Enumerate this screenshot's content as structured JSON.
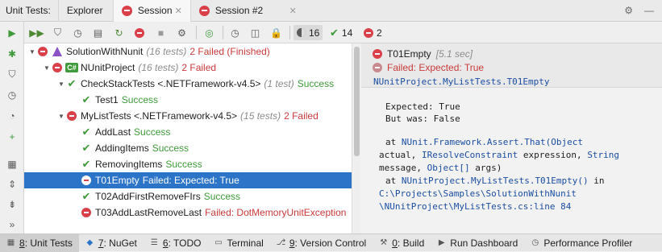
{
  "titlebar": {
    "label": "Unit Tests:",
    "tabs": [
      {
        "label": "Explorer"
      },
      {
        "label": "Session"
      },
      {
        "label": "Session #2"
      }
    ]
  },
  "toolbar": {
    "counters": {
      "all": "16",
      "passed": "14",
      "failed": "2"
    }
  },
  "tree": [
    {
      "name": "SolutionWithNunit",
      "meta": "(16 tests)",
      "status": "2 Failed (Finished)"
    },
    {
      "name": "NUnitProject",
      "meta": "(16 tests)",
      "status": "2 Failed"
    },
    {
      "name": "CheckStackTests <.NETFramework-v4.5>",
      "meta": "(1 test)",
      "status": "Success"
    },
    {
      "name": "Test1",
      "status": "Success"
    },
    {
      "name": "MyListTests <.NETFramework-v4.5>",
      "meta": "(15 tests)",
      "status": "2 Failed"
    },
    {
      "name": "AddLast",
      "status": "Success"
    },
    {
      "name": "AddingItems",
      "status": "Success"
    },
    {
      "name": "RemovingItems",
      "status": "Success"
    },
    {
      "name": "T01Empty",
      "status": "Failed:  Expected: True"
    },
    {
      "name": "T02AddFirstRemoveFIrs",
      "status": "Success"
    },
    {
      "name": "T03AddLastRemoveLast",
      "status": "Failed: DotMemoryUnitException"
    }
  ],
  "detail": {
    "test_name": "T01Empty",
    "duration": "[5.1 sec]",
    "failed_msg": "Failed: Expected: True",
    "full_name": "NUnitProject.MyListTests.T01Empty",
    "output_lines": [
      "Expected: True",
      "But was:  False"
    ],
    "trace": {
      "at1": "at",
      "assert_call": "NUnit.Framework.Assert.That(Object",
      "line2a": "actual,",
      "line2b": "IResolveConstraint",
      "line2c": "expression,",
      "line2d": "String",
      "line3a": "message,",
      "line3b": "Object[]",
      "line3c": "args)",
      "at2": "at",
      "method": "NUnitProject.MyListTests.T01Empty()",
      "in": "in",
      "path1": "C:\\Projects\\Samples\\SolutionWithNunit",
      "path2": "\\NUnitProject\\MyListTests.cs:line 84"
    }
  },
  "bottombar": {
    "items": [
      {
        "num": "8",
        "label": ": Unit Tests"
      },
      {
        "num": "7",
        "label": ": NuGet"
      },
      {
        "num": "6",
        "label": ": TODO"
      },
      {
        "num": "",
        "label": "Terminal"
      },
      {
        "num": "9",
        "label": ": Version Control"
      },
      {
        "num": "0",
        "label": ": Build"
      },
      {
        "num": "",
        "label": "Run Dashboard"
      },
      {
        "num": "",
        "label": "Performance Profiler"
      }
    ]
  }
}
